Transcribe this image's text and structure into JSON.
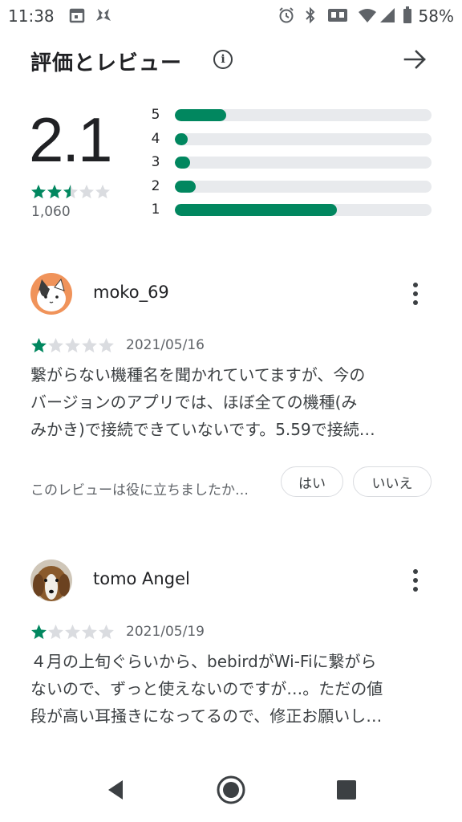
{
  "status_bar": {
    "time": "11:38",
    "battery": "58%",
    "icons": [
      "calendar-icon",
      "bug-icon",
      "alarm-icon",
      "bluetooth-icon",
      "vibrate-icon",
      "wifi-icon",
      "signal-icon",
      "battery-icon"
    ]
  },
  "header": {
    "title": "評価とレビュー",
    "info_icon": "info-icon",
    "arrow_icon": "arrow-right-icon"
  },
  "summary": {
    "score": "2.1",
    "rating_stars": 2.5,
    "total": "1,060",
    "accent_color": "#01875f",
    "distribution": [
      {
        "label": "5",
        "fraction": 0.2
      },
      {
        "label": "4",
        "fraction": 0.05
      },
      {
        "label": "3",
        "fraction": 0.06
      },
      {
        "label": "2",
        "fraction": 0.08
      },
      {
        "label": "1",
        "fraction": 0.63
      }
    ]
  },
  "reviews": [
    {
      "author": "moko_69",
      "rating": 1,
      "date": "2021/05/16",
      "body_lines": [
        "繋がらない機種名を聞かれていてますが、今の",
        "バージョンのアプリでは、ほぼ全ての機種(み",
        "みかき)で接続できていないです。5.59で接続…"
      ],
      "helpful_prompt": "このレビューは役に立ちましたか…",
      "yes_label": "はい",
      "no_label": "いいえ"
    },
    {
      "author": "tomo Angel",
      "rating": 1,
      "date": "2021/05/19",
      "body_lines": [
        "４月の上旬ぐらいから、bebirdがWi-Fiに繋がら",
        "ないので、ずっと使えないのですが…。ただの値",
        "段が高い耳掻きになってるので、修正お願いし…"
      ]
    }
  ],
  "nav": {
    "back_icon": "back-triangle-icon",
    "home_icon": "home-circle-icon",
    "recents_icon": "recents-square-icon"
  }
}
